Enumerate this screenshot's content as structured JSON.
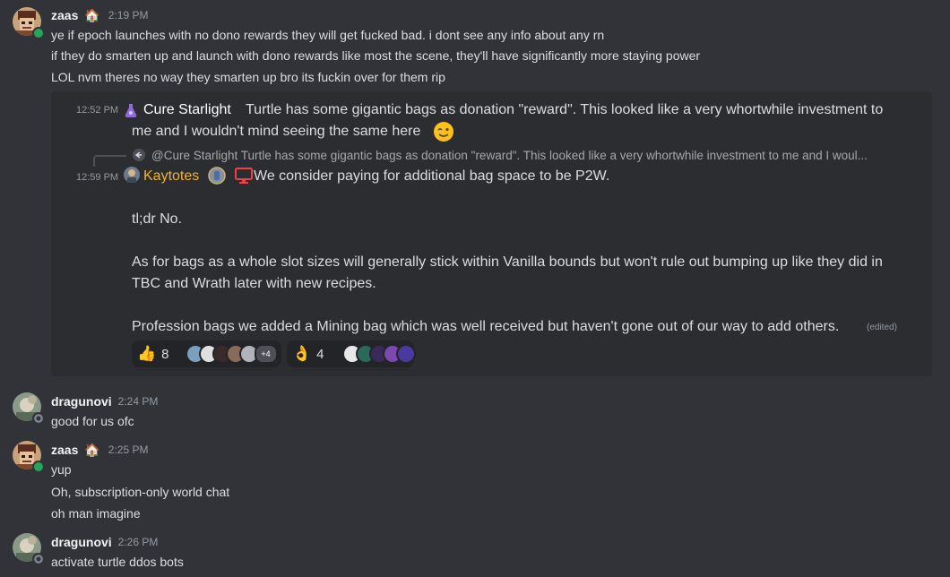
{
  "messages": [
    {
      "author": "zaas",
      "time": "2:19 PM",
      "lines": [
        "ye if epoch launches with no dono rewards they will get fucked bad. i dont see any info about any rn",
        "if they do smarten up and launch with dono rewards like most the scene, they'll have significantly more staying power",
        "LOL nvm theres no way they smarten up bro its fuckin over for them rip"
      ]
    },
    {
      "author": "dragunovi",
      "time": "2:24 PM",
      "lines": [
        "good for us ofc"
      ]
    },
    {
      "author": "zaas",
      "time": "2:25 PM",
      "lines": [
        "yup",
        "Oh, subscription-only world chat",
        "oh man imagine"
      ]
    },
    {
      "author": "dragunovi",
      "time": "2:26 PM",
      "lines": [
        "activate turtle ddos bots"
      ]
    }
  ],
  "quote": {
    "first": {
      "time": "12:52 PM",
      "author": "Cure Starlight",
      "text_line1": "Turtle has some gigantic bags as donation \"reward\". This looked like a very whortwhile investment to",
      "text_line2": "me and I wouldn't mind seeing the same here"
    },
    "reply_ref": "@Cure Starlight Turtle has some gigantic bags as donation \"reward\". This looked like a very whortwhile investment to me and I woul...",
    "second": {
      "time": "12:59 PM",
      "author": "Kaytotes",
      "line1": "We consider paying for additional bag space to be P2W.",
      "line2": "tl;dr No.",
      "line3": "As for bags as a whole slot sizes will generally stick within Vanilla bounds but won't rule out bumping up like they did in",
      "line4": "TBC and Wrath later with new recipes.",
      "line5": "Profession bags we added a Mining bag which was well received but haven't gone out of our way to add others.",
      "edited": "(edited)"
    },
    "reactions": [
      {
        "emoji": "thumbs-up",
        "count": "8",
        "more": "+4"
      },
      {
        "emoji": "ok-hand",
        "count": "4"
      }
    ]
  },
  "colors": {
    "background": "#313338",
    "embed": "#2b2d31",
    "online": "#23a55a",
    "kaytotes": "#f0b232"
  }
}
